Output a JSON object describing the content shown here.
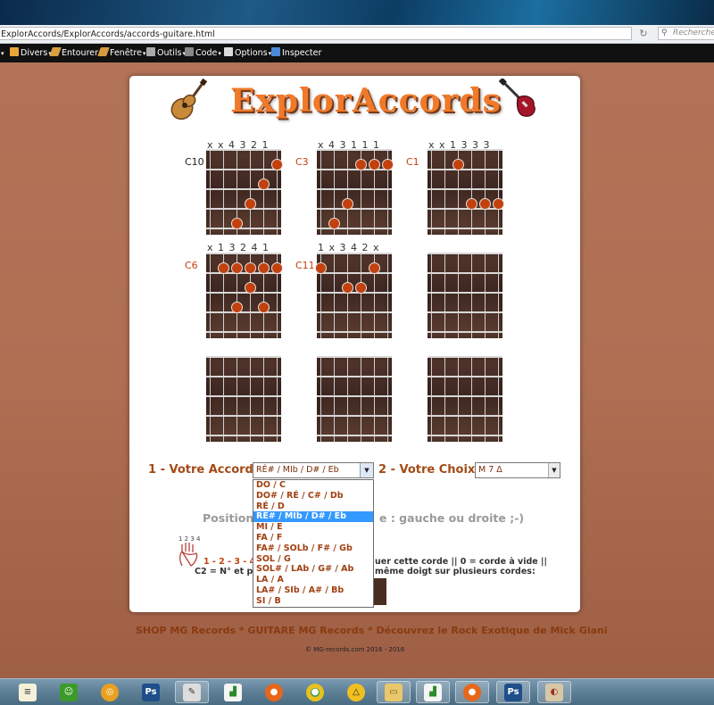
{
  "browser": {
    "url": "ExplorAccords/ExplorAccords/accords-guitare.html",
    "search_placeholder": "Rechercher",
    "reload_icon": "reload-icon"
  },
  "devtoolbar": {
    "items": [
      "Divers",
      "Entourer",
      "Fenêtre",
      "Outils",
      "Code",
      "Options",
      "Inspecter"
    ]
  },
  "page": {
    "logo": "ExplorAccords",
    "chords": [
      {
        "name": "C10",
        "fingering": "x x 4 3 2 1"
      },
      {
        "name": "C3",
        "fingering": "x 4 3 1 1 1"
      },
      {
        "name": "C1",
        "fingering": "x x 1 3 3 3"
      },
      {
        "name": "C6",
        "fingering": "x 1 3 2 4 1"
      },
      {
        "name": "C11",
        "fingering": "1 x 3 4 2 x"
      }
    ],
    "form": {
      "accord_label": "1 - Votre Accord",
      "accord_value": "RÉ# / MIb   /   D# / Eb",
      "choix_label": "2 - Votre Choix",
      "choix_value": "M 7 Δ",
      "options": [
        "DO  /   C",
        "DO# / RÉ   /   C# / Db",
        "RÉ   /   D",
        "RÉ# / MIb   /   D# / Eb",
        "MI   /   E",
        "FA   /   F",
        "FA# / SOLb   /   F# / Gb",
        "SOL   /   G",
        "SOL# / LAb   /   G# / Ab",
        "LA   /   A",
        "LA# / SIb   /   A# / Bb",
        "SI   /   B"
      ],
      "selected_index": 3
    },
    "position_label": "Position",
    "position_rest": "e : gauche ou droite ;-)",
    "help": {
      "left_line1": "1 - 2 - 3 - 4",
      "right_line1": "uer cette corde || 0 = corde à vide ||",
      "left_line2": "C2 = N° et po",
      "right_line2": "même doigt sur plusieurs cordes:"
    },
    "footer_links": "SHOP MG Records * GUITARE MG Records * Découvrez le Rock Exotique de Mick Giani",
    "copyright": "© MG-records.com 2016 - 2016"
  },
  "colors": {
    "accent": "#c2410f",
    "label": "#a34a16",
    "selection": "#3399ff"
  },
  "taskbar": {
    "icons": [
      "notepad-icon",
      "frog-icon",
      "cyclone-icon",
      "photoshop-icon",
      "paint-tools-icon",
      "chart-editor-icon",
      "firefox-icon",
      "chrome-icon",
      "warning-app-icon",
      "folder-icon",
      "editor-icon",
      "firefox-icon",
      "photoshop-icon",
      "palette-icon"
    ]
  }
}
